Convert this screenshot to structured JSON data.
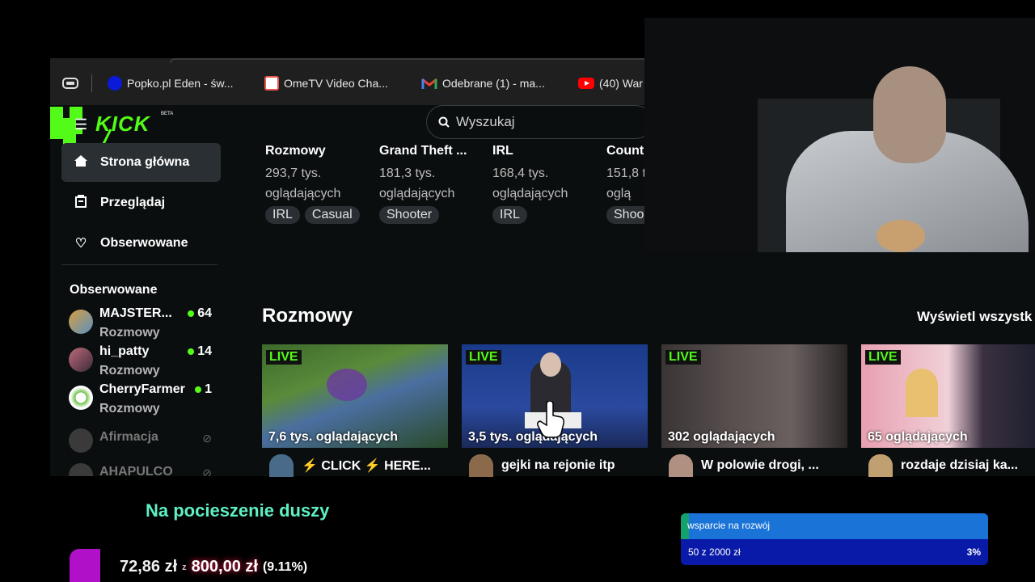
{
  "bookmarks": [
    {
      "label": "Popko.pl Eden - św...",
      "icon": "popko-favicon",
      "color": "#0a1ad6"
    },
    {
      "label": "OmeTV Video Cha...",
      "icon": "ometv-favicon",
      "color": "#e8554a"
    },
    {
      "label": "Odebrane (1) - ma...",
      "icon": "gmail-favicon",
      "color": "#ea4335"
    },
    {
      "label": "(40) War",
      "icon": "youtube-favicon",
      "color": "#ff0000"
    }
  ],
  "site": {
    "logo_text": "KICK",
    "logo_badge": "BETA",
    "accent": "#53fc18"
  },
  "search": {
    "placeholder": "Wyszukaj"
  },
  "nav": [
    {
      "label": "Strona główna",
      "icon": "home-icon"
    },
    {
      "label": "Przeglądaj",
      "icon": "browse-icon"
    },
    {
      "label": "Obserwowane",
      "icon": "heart-icon"
    }
  ],
  "sidebar": {
    "heading": "Obserwowane",
    "follows": [
      {
        "name": "MAJSTER...",
        "category": "Rozmowy",
        "viewers": "64"
      },
      {
        "name": "hi_patty",
        "category": "Rozmowy",
        "viewers": "14"
      },
      {
        "name": "CherryFarmer",
        "category": "Rozmowy",
        "viewers": "1"
      },
      {
        "name": "Afirmacja",
        "offline": true
      },
      {
        "name": "AHAPULCO",
        "offline": true
      }
    ]
  },
  "categories": [
    {
      "title": "Rozmowy",
      "viewers": "293,7 tys.",
      "label": "oglądających",
      "tags": [
        "IRL",
        "Casual"
      ]
    },
    {
      "title": "Grand Theft ...",
      "viewers": "181,3 tys.",
      "label": "oglądających",
      "tags": [
        "Shooter"
      ]
    },
    {
      "title": "IRL",
      "viewers": "168,4 tys.",
      "label": "oglądających",
      "tags": [
        "IRL"
      ]
    },
    {
      "title": "Count",
      "viewers": "151,8 t",
      "label": "oglą",
      "tags": [
        "Shoo"
      ]
    }
  ],
  "section": {
    "title": "Rozmowy",
    "see_all": "Wyświetl wszystk"
  },
  "streams": [
    {
      "live": "LIVE",
      "viewers": "7,6 tys. oglądających",
      "title": "⚡ CLICK ⚡ HERE..."
    },
    {
      "live": "LIVE",
      "viewers": "3,5 tys. oglądających",
      "title": "gejki na rejonie itp"
    },
    {
      "live": "LIVE",
      "viewers": "302 oglądających",
      "title": "W polowie drogi, ..."
    },
    {
      "live": "LIVE",
      "viewers": "65 oglądających",
      "title": "rozdaje dzisiaj ka..."
    }
  ],
  "overlay": {
    "donate_title": "Na pocieszenie duszy",
    "donate_current": "72,86 zł",
    "donate_sep": "z",
    "donate_target": "800,00 zł",
    "donate_percent": "(9.11%)",
    "goal_label": "wsparcie na rozwój",
    "goal_amount": "50 z 2000 zł",
    "goal_percent_text": "3%",
    "goal_fraction": 0.025
  }
}
